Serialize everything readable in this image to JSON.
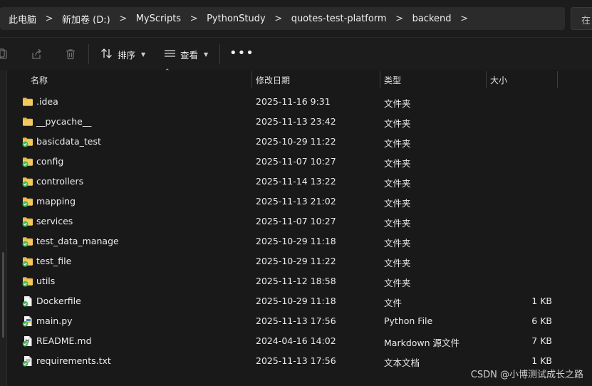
{
  "breadcrumb": {
    "items": [
      {
        "label": "此电脑"
      },
      {
        "label": "新加卷 (D:)"
      },
      {
        "label": "MyScripts"
      },
      {
        "label": "PythonStudy"
      },
      {
        "label": "quotes-test-platform"
      },
      {
        "label": "backend"
      }
    ]
  },
  "search": {
    "placeholder": "在"
  },
  "toolbar": {
    "sort_label": "排序",
    "view_label": "查看",
    "more_label": "•••",
    "copy_icon": "copy-icon",
    "share_icon": "share-icon",
    "delete_icon": "trash-icon"
  },
  "columns": {
    "name": "名称",
    "date": "修改日期",
    "type": "类型",
    "size": "大小"
  },
  "files": [
    {
      "name": ".idea",
      "date": "2025-11-16 9:31",
      "type": "文件夹",
      "size": "",
      "icon": "folder-icon"
    },
    {
      "name": "__pycache__",
      "date": "2025-11-13 23:42",
      "type": "文件夹",
      "size": "",
      "icon": "folder-icon"
    },
    {
      "name": "basicdata_test",
      "date": "2025-10-29 11:22",
      "type": "文件夹",
      "size": "",
      "icon": "folder-synced-icon"
    },
    {
      "name": "config",
      "date": "2025-11-07 10:27",
      "type": "文件夹",
      "size": "",
      "icon": "folder-synced-icon"
    },
    {
      "name": "controllers",
      "date": "2025-11-14 13:22",
      "type": "文件夹",
      "size": "",
      "icon": "folder-synced-icon"
    },
    {
      "name": "mapping",
      "date": "2025-11-13 21:02",
      "type": "文件夹",
      "size": "",
      "icon": "folder-synced-icon"
    },
    {
      "name": "services",
      "date": "2025-11-07 10:27",
      "type": "文件夹",
      "size": "",
      "icon": "folder-synced-icon"
    },
    {
      "name": "test_data_manage",
      "date": "2025-10-29 11:18",
      "type": "文件夹",
      "size": "",
      "icon": "folder-synced-icon"
    },
    {
      "name": "test_file",
      "date": "2025-10-29 11:22",
      "type": "文件夹",
      "size": "",
      "icon": "folder-synced-icon"
    },
    {
      "name": "utils",
      "date": "2025-11-12 18:58",
      "type": "文件夹",
      "size": "",
      "icon": "folder-synced-icon"
    },
    {
      "name": "Dockerfile",
      "date": "2025-10-29 11:18",
      "type": "文件",
      "size": "1 KB",
      "icon": "file-synced-icon"
    },
    {
      "name": "main.py",
      "date": "2025-11-13 17:56",
      "type": "Python File",
      "size": "6 KB",
      "icon": "python-file-icon"
    },
    {
      "name": "README.md",
      "date": "2024-04-16 14:02",
      "type": "Markdown 源文件",
      "size": "7 KB",
      "icon": "markdown-file-icon"
    },
    {
      "name": "requirements.txt",
      "date": "2025-11-13 17:56",
      "type": "文本文档",
      "size": "1 KB",
      "icon": "text-file-icon"
    }
  ],
  "watermark": "CSDN @小博测试成长之路",
  "colors": {
    "folder": "#e8b84a",
    "sync_badge": "#3fb950",
    "background": "#191919"
  }
}
